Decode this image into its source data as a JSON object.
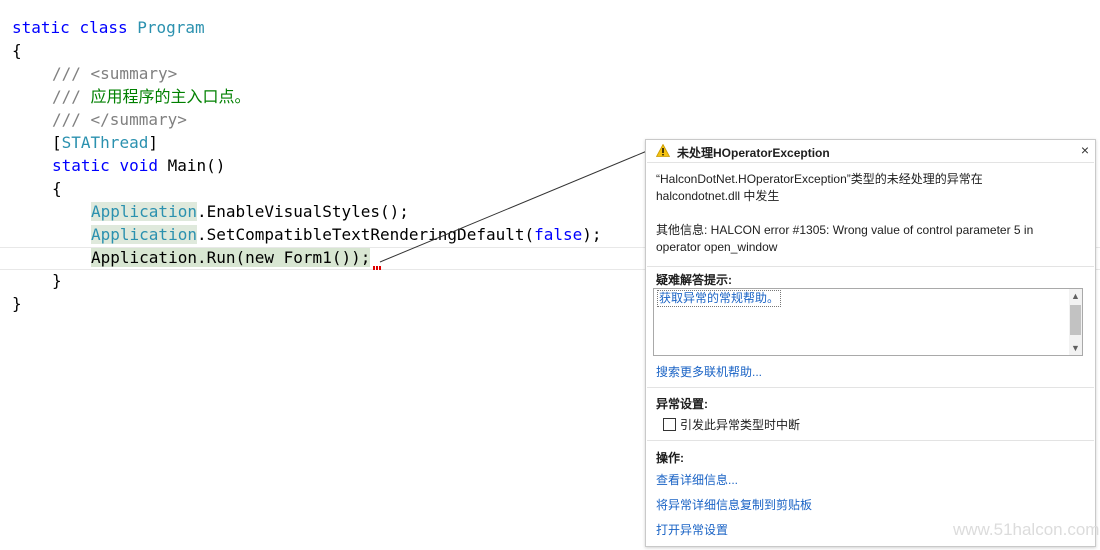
{
  "code": {
    "line1": {
      "kw1": "static",
      "kw2": "class",
      "type": "Program"
    },
    "line2": "{",
    "line3": {
      "prefix": "/// ",
      "tag": "<summary>"
    },
    "line4": {
      "prefix": "/// ",
      "text": "应用程序的主入口点。"
    },
    "line5": {
      "prefix": "/// ",
      "tag": "</summary>"
    },
    "line6": {
      "open": "[",
      "attr": "STAThread",
      "close": "]"
    },
    "line7": {
      "kw1": "static",
      "kw2": "void",
      "rest": "Main()"
    },
    "line8": "{",
    "line9": {
      "type": "Application",
      "rest": ".EnableVisualStyles();"
    },
    "line10": {
      "type": "Application",
      "rest1": ".SetCompatibleTextRenderingDefault(",
      "kw": "false",
      "rest2": ");"
    },
    "line11": "Application.Run(new Form1());",
    "line12": "}",
    "line13": "}"
  },
  "dialog": {
    "title": "未处理HOperatorException",
    "close": "×",
    "message_line1": "“HalconDotNet.HOperatorException”类型的未经处理的异常在",
    "message_line2": "halcondotnet.dll 中发生",
    "extra_line1": "其他信息: HALCON error #1305: Wrong value of control parameter 5 in",
    "extra_line2": "operator open_window",
    "tips_header": "疑难解答提示:",
    "tips_link": "获取异常的常规帮助。",
    "search_link": "搜索更多联机帮助...",
    "exception_settings_header": "异常设置:",
    "break_checkbox_label": "引发此异常类型时中断",
    "break_checkbox_checked": false,
    "actions_header": "操作:",
    "action_view_details": "查看详细信息...",
    "action_copy": "将异常详细信息复制到剪贴板",
    "action_open_settings": "打开异常设置"
  },
  "watermark": "www.51halcon.com",
  "colors": {
    "keyword": "#0000ff",
    "type": "#2b91af",
    "comment": "#008000",
    "link": "#1a63c5",
    "warning": "#f5c211"
  }
}
